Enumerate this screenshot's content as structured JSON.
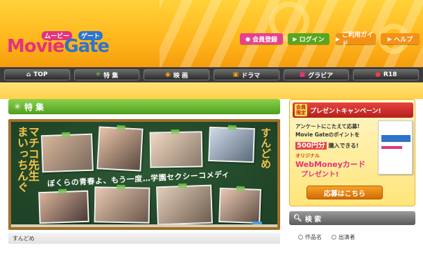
{
  "header": {
    "logo_text_movie": "Movie",
    "logo_text_gate": "Gate",
    "logo_kana_movie": "ムービー",
    "logo_kana_gate": "ゲート",
    "buttons": {
      "register": "会員登録",
      "login": "ログイン",
      "guide": "ご利用ガイド",
      "help": "ヘルプ"
    }
  },
  "nav": {
    "items": [
      {
        "label": "TOP",
        "icon": "home-icon"
      },
      {
        "label": "特 集",
        "icon": "sparkle-icon"
      },
      {
        "label": "映 画",
        "icon": "film-icon"
      },
      {
        "label": "ドラマ",
        "icon": "tv-icon"
      },
      {
        "label": "グラビア",
        "icon": "camera-icon"
      },
      {
        "label": "R18",
        "icon": "r18-icon"
      }
    ]
  },
  "section": {
    "title": "特 集"
  },
  "feature": {
    "vertical_title_left": "まいっちんぐ",
    "vertical_title_left2": "マチコ先生",
    "vertical_title_right": "すんどめ",
    "tagline": "ぼくらの青春よ、もう一度…学園セクシーコメディ",
    "caption": "すんどめ"
  },
  "campaign": {
    "badge": "会員限定",
    "title": "プレゼントキャンペーン!",
    "line1": "アンケートにこたえて応募!",
    "line2": "Movie Gateのポイントを",
    "line3_amount": "500円分",
    "line3_rest": "購入できる!",
    "line4": "オリジナル",
    "line5": "WebMoneyカード",
    "line6": "プレゼント!",
    "button": "応募はこちら"
  },
  "search": {
    "title": "検 索",
    "options": [
      "作品名",
      "出演者"
    ]
  }
}
